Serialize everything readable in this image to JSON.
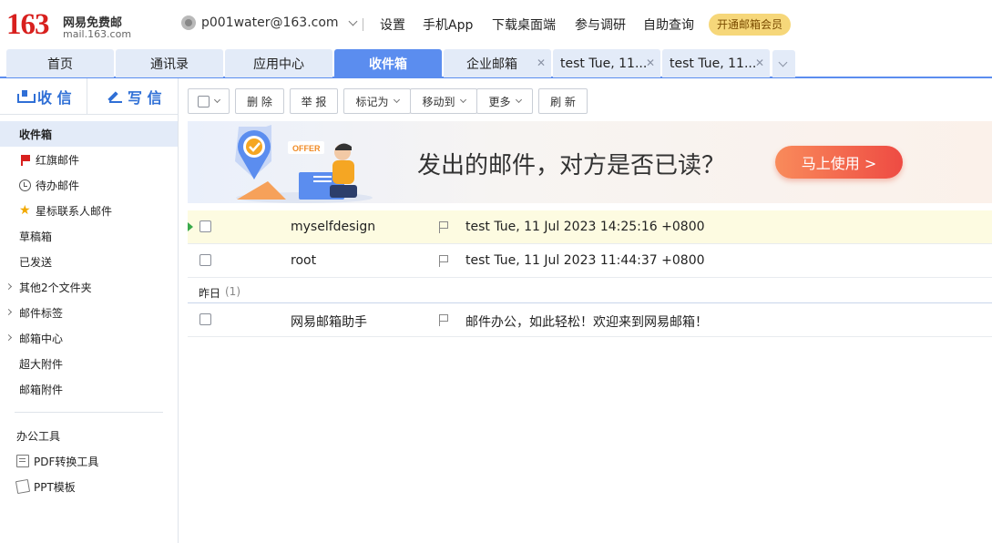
{
  "header": {
    "logo_number": "163",
    "logo_name": "网易免费邮",
    "logo_domain": "mail.163.com",
    "account": "p001water@163.com",
    "links": [
      "设置",
      "手机App",
      "下载桌面端",
      "参与调研",
      "自助查询"
    ],
    "vip_button": "开通邮箱会员"
  },
  "tabs": [
    {
      "label": "首页",
      "active": false
    },
    {
      "label": "通讯录",
      "active": false
    },
    {
      "label": "应用中心",
      "active": false
    },
    {
      "label": "收件箱",
      "active": true
    },
    {
      "label": "企业邮箱",
      "active": false,
      "closable": true
    },
    {
      "label": "test Tue, 11...",
      "active": false,
      "closable": true
    },
    {
      "label": "test Tue, 11...",
      "active": false,
      "closable": true
    }
  ],
  "sidebar": {
    "receive_label": "收 信",
    "write_label": "写 信",
    "items": [
      {
        "label": "收件箱",
        "active": true
      },
      {
        "label": "红旗邮件",
        "icon": "red-flag-icon"
      },
      {
        "label": "待办邮件",
        "icon": "clock-icon"
      },
      {
        "label": "星标联系人邮件",
        "icon": "star-icon"
      },
      {
        "label": "草稿箱"
      },
      {
        "label": "已发送"
      },
      {
        "label": "其他2个文件夹",
        "expandable": true
      },
      {
        "label": "邮件标签",
        "expandable": true
      },
      {
        "label": "邮箱中心",
        "expandable": true
      },
      {
        "label": "超大附件"
      },
      {
        "label": "邮箱附件"
      }
    ],
    "tools_title": "办公工具",
    "tools": [
      {
        "label": "PDF转换工具",
        "icon": "pdf-icon"
      },
      {
        "label": "PPT模板",
        "icon": "ppt-icon"
      }
    ]
  },
  "toolbar": {
    "delete": "删 除",
    "report": "举 报",
    "mark_as": "标记为",
    "move_to": "移动到",
    "more": "更多",
    "refresh": "刷 新"
  },
  "banner": {
    "badge": "OFFER",
    "text": "发出的邮件，对方是否已读？",
    "button": "马上使用 >"
  },
  "mails": [
    {
      "from": "myselfdesign",
      "subject": "test Tue, 11 Jul 2023 14:25:16 +0800",
      "unread": true
    },
    {
      "from": "root",
      "subject": "test Tue, 11 Jul 2023 11:44:37 +0800",
      "unread": false
    }
  ],
  "group": {
    "label": "昨日",
    "count": "(1)"
  },
  "mails_yesterday": [
    {
      "from": "网易邮箱助手",
      "subject": "邮件办公，如此轻松！欢迎来到网易邮箱！",
      "unread": false
    }
  ],
  "colors": {
    "accent": "#5b8def",
    "brand_red": "#d8201e",
    "tab_bg": "#e3ebf8",
    "unread_row": "#fdfbe1",
    "banner_button": "#ee4b43"
  }
}
